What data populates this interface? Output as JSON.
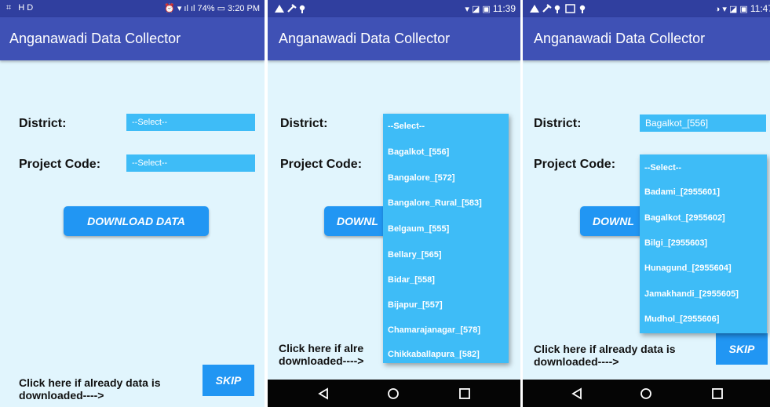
{
  "app_title": "Anganawadi Data Collector",
  "district_label": "District:",
  "project_label": "Project Code:",
  "select_placeholder": "--Select--",
  "download_label": "DOWNLOAD DATA",
  "download_partial": "DOWNL",
  "footer_line1": "Click here if already data is",
  "footer_line2": "downloaded---->",
  "skip_label": "SKIP",
  "screen1": {
    "status_left": "⌗ HD",
    "status_right": "⏰ ▾ ıl ıl 74% ▭ 3:20 PM"
  },
  "screen2": {
    "status_time": "11:39",
    "footer_line1": "Click here if alre",
    "footer_line2": "downloaded---->",
    "district_options": [
      "--Select--",
      "Bagalkot_[556]",
      "Bangalore_[572]",
      "Bangalore_Rural_[583]",
      "Belgaum_[555]",
      "Bellary_[565]",
      "Bidar_[558]",
      "Bijapur_[557]",
      "Chamarajanagar_[578]",
      "Chikkaballapura_[582]"
    ]
  },
  "screen3": {
    "status_time": "11:47",
    "district_value": "Bagalkot_[556]",
    "project_options": [
      "--Select--",
      "Badami_[2955601]",
      "Bagalkot_[2955602]",
      "Bilgi_[2955603]",
      "Hunagund_[2955604]",
      "Jamakhandi_[2955605]",
      "Mudhol_[2955606]"
    ]
  },
  "colors": {
    "appbar": "#3f51b5",
    "statusbar": "#303f9f",
    "accent": "#2196f3",
    "field": "#3ebcf7",
    "background": "#e1f5fd"
  }
}
